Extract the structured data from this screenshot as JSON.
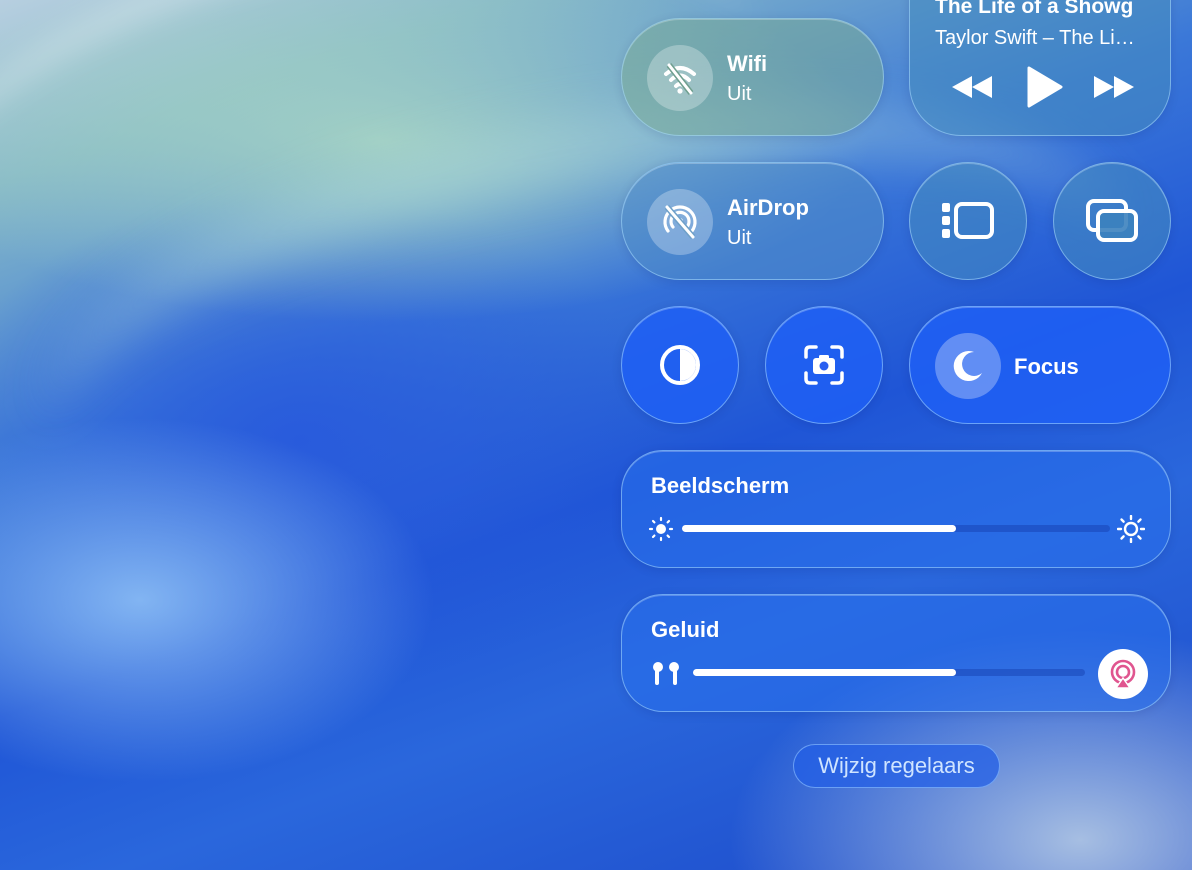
{
  "wifi": {
    "title": "Wifi",
    "status": "Uit",
    "icon": "wifi-off-icon"
  },
  "now_playing": {
    "title": "The Life of a Showg",
    "subtitle": "Taylor Swift – The Li…"
  },
  "airdrop": {
    "title": "AirDrop",
    "status": "Uit",
    "icon": "airdrop-off-icon"
  },
  "focus": {
    "label": "Focus",
    "icon": "moon-icon"
  },
  "display": {
    "label": "Beeldscherm",
    "level_percent": 64
  },
  "sound": {
    "label": "Geluid",
    "level_percent": 67
  },
  "edit_controls": {
    "label": "Wijzig regelaars"
  },
  "colors": {
    "accent": "#1f5ff5",
    "airplay_icon": "#e0558f"
  }
}
